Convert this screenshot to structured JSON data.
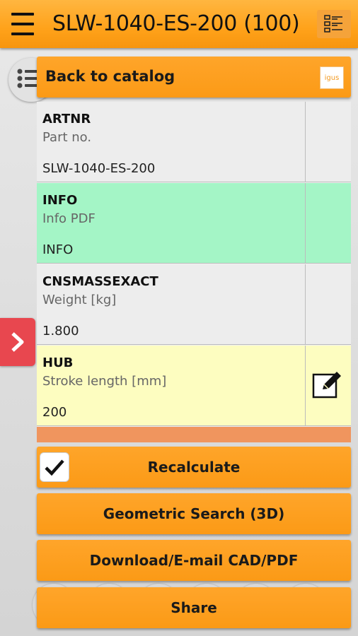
{
  "app": {
    "title": "SLW-1040-ES-200 (100)",
    "accent": "#fb9a16"
  },
  "icons": {
    "menu": "hamburger-menu-icon",
    "grid": "table-view-icon",
    "list": "list-icon",
    "expand": "chevron-right-icon",
    "edit": "edit-pencil-icon",
    "check": "checkmark-icon"
  },
  "panel": {
    "back_label": "Back to catalog",
    "logo_text": "igus"
  },
  "rows": [
    {
      "code": "ARTNR",
      "desc": "Part no.",
      "value": "SLW-1040-ES-200",
      "color": "#ededed"
    },
    {
      "code": "INFO",
      "desc": "Info PDF",
      "value": "INFO",
      "color": "#a4f5c6"
    },
    {
      "code": "CNSMASSEXACT",
      "desc": "Weight [kg]",
      "value": "1.800",
      "color": "#ededed"
    },
    {
      "code": "HUB",
      "desc": "Stroke length [mm]",
      "value": "200",
      "color": "#fdfdc0"
    }
  ],
  "peek_row_color": "#f0955e",
  "actions": {
    "recalculate": "Recalculate",
    "recalculate_checked": true,
    "geometric_search": "Geometric Search (3D)",
    "download": "Download/E-mail CAD/PDF",
    "share": "Share"
  }
}
